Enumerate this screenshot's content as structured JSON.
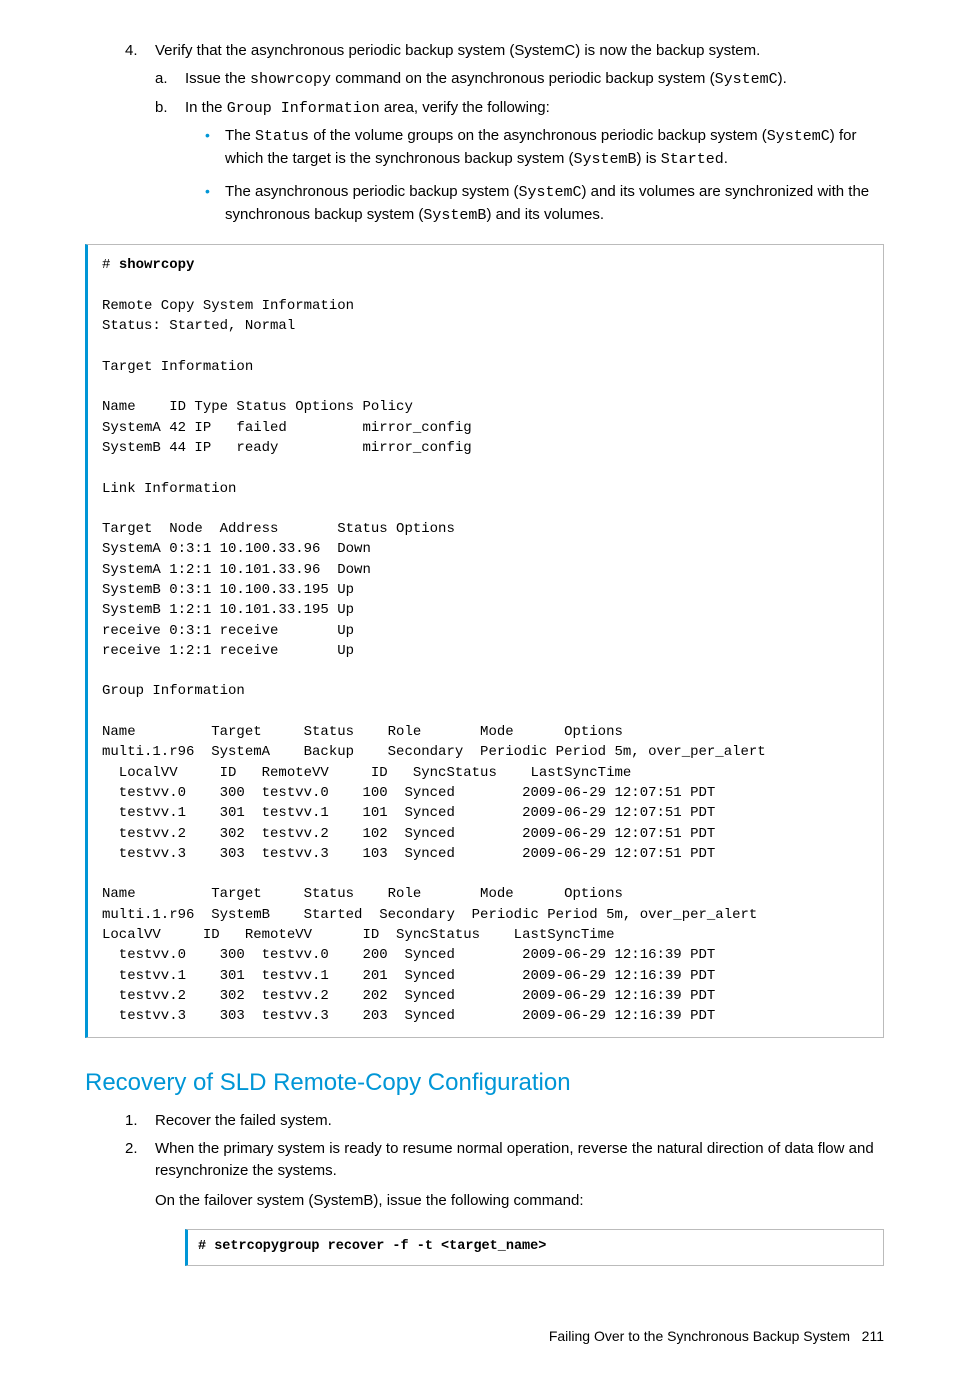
{
  "step4": {
    "marker": "4.",
    "text_a": "Verify that the asynchronous periodic backup system (SystemC) is now the backup system.",
    "sub_a": {
      "marker": "a.",
      "pre": "Issue the ",
      "cmd": "showrcopy",
      "post": " command on the asynchronous periodic backup system (",
      "sys": "SystemC",
      "end": ")."
    },
    "sub_b": {
      "marker": "b.",
      "pre": "In the ",
      "cmd": "Group Information",
      "post": " area, verify the following:"
    },
    "bullet1": {
      "p1": "The ",
      "status": "Status",
      "p2": " of the volume groups on the asynchronous periodic backup system (",
      "sysC": "SystemC",
      "p3": ") for which the target is the synchronous backup system (",
      "sysB": "SystemB",
      "p4": ") is ",
      "started": "Started",
      "p5": "."
    },
    "bullet2": {
      "p1": "The asynchronous periodic backup system (",
      "sysC": "SystemC",
      "p2": ") and its volumes are synchronized with the synchronous backup system (",
      "sysB": "SystemB",
      "p3": ") and its volumes."
    }
  },
  "code1": {
    "prompt": "# ",
    "cmd": "showrcopy",
    "body": "Remote Copy System Information\nStatus: Started, Normal\n\nTarget Information\n\nName    ID Type Status Options Policy\nSystemA 42 IP   failed         mirror_config\nSystemB 44 IP   ready          mirror_config\n\nLink Information\n\nTarget  Node  Address       Status Options\nSystemA 0:3:1 10.100.33.96  Down\nSystemA 1:2:1 10.101.33.96  Down\nSystemB 0:3:1 10.100.33.195 Up\nSystemB 1:2:1 10.101.33.195 Up\nreceive 0:3:1 receive       Up\nreceive 1:2:1 receive       Up\n\nGroup Information\n\nName         Target     Status    Role       Mode      Options\nmulti.1.r96  SystemA    Backup    Secondary  Periodic Period 5m, over_per_alert\n  LocalVV     ID   RemoteVV     ID   SyncStatus    LastSyncTime\n  testvv.0    300  testvv.0    100  Synced        2009-06-29 12:07:51 PDT\n  testvv.1    301  testvv.1    101  Synced        2009-06-29 12:07:51 PDT\n  testvv.2    302  testvv.2    102  Synced        2009-06-29 12:07:51 PDT\n  testvv.3    303  testvv.3    103  Synced        2009-06-29 12:07:51 PDT\n\nName         Target     Status    Role       Mode      Options\nmulti.1.r96  SystemB    Started  Secondary  Periodic Period 5m, over_per_alert\nLocalVV     ID   RemoteVV      ID  SyncStatus    LastSyncTime\n  testvv.0    300  testvv.0    200  Synced        2009-06-29 12:16:39 PDT\n  testvv.1    301  testvv.1    201  Synced        2009-06-29 12:16:39 PDT\n  testvv.2    302  testvv.2    202  Synced        2009-06-29 12:16:39 PDT\n  testvv.3    303  testvv.3    203  Synced        2009-06-29 12:16:39 PDT"
  },
  "heading": "Recovery of SLD Remote-Copy Configuration",
  "recovery": {
    "s1": {
      "marker": "1.",
      "text": "Recover the failed system."
    },
    "s2": {
      "marker": "2.",
      "text": "When the primary system is ready to resume normal operation, reverse the natural direction of data flow and resynchronize the systems."
    },
    "s2_para": "On the failover system (SystemB), issue the following command:"
  },
  "code2": "# setrcopygroup recover -f -t <target_name>",
  "footer": {
    "label": "Failing Over to the Synchronous Backup System",
    "page": "211"
  }
}
